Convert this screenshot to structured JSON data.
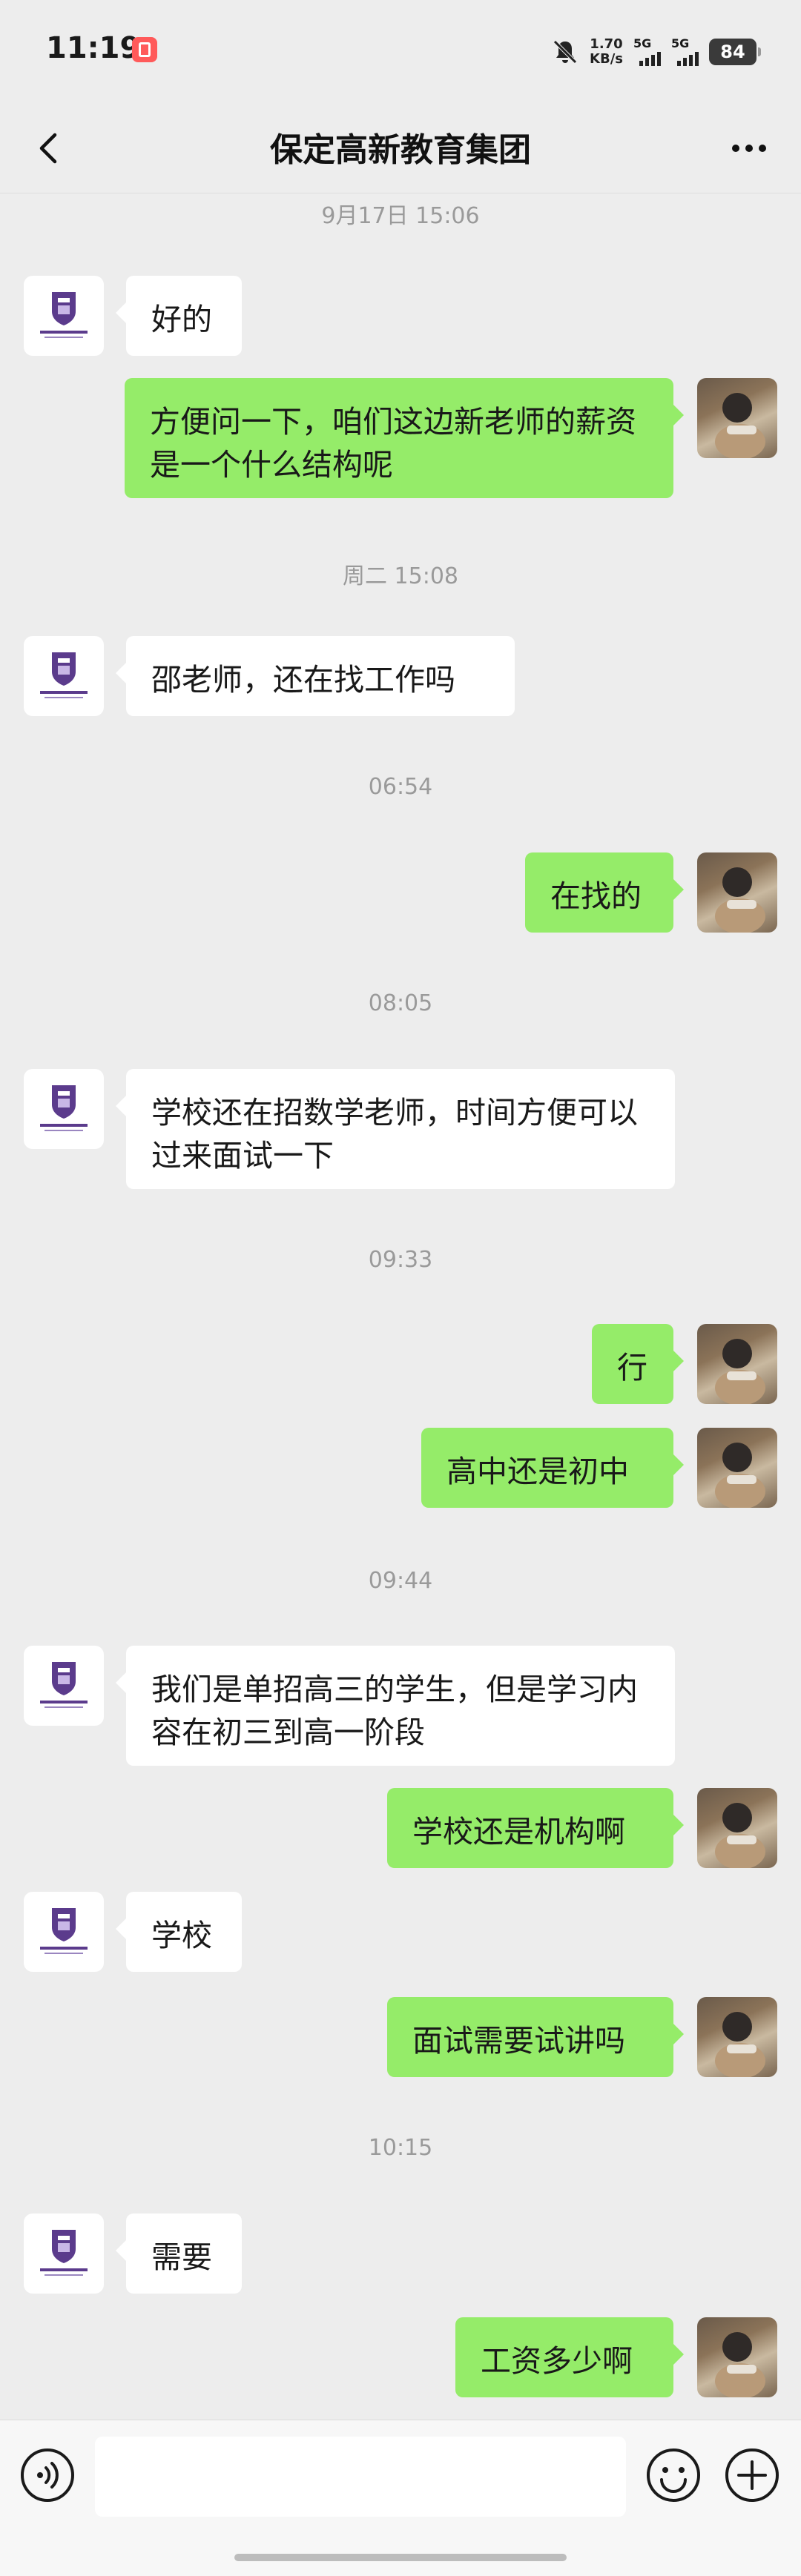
{
  "status_bar": {
    "time": "11:19",
    "net_speed_value": "1.70",
    "net_speed_unit": "KB/s",
    "sim1_label": "5G",
    "sim2_label": "5G",
    "battery": "84"
  },
  "header": {
    "title": "保定高新教育集团"
  },
  "timestamps": [
    "9月17日 15:06",
    "周二 15:08",
    "06:54",
    "08:05",
    "09:33",
    "09:44",
    "10:15"
  ],
  "messages": [
    {
      "side": "left",
      "text": "好的"
    },
    {
      "side": "right",
      "text": "方便问一下，咱们这边新老师的薪资是一个什么结构呢"
    },
    {
      "side": "left",
      "text": "邵老师，还在找工作吗"
    },
    {
      "side": "right",
      "text": "在找的"
    },
    {
      "side": "left",
      "text": "学校还在招数学老师，时间方便可以过来面试一下"
    },
    {
      "side": "right",
      "text": "行"
    },
    {
      "side": "right",
      "text": "高中还是初中"
    },
    {
      "side": "left",
      "text": "我们是单招高三的学生，但是学习内容在初三到高一阶段"
    },
    {
      "side": "right",
      "text": "学校还是机构啊"
    },
    {
      "side": "left",
      "text": "学校"
    },
    {
      "side": "right",
      "text": "面试需要试讲吗"
    },
    {
      "side": "left",
      "text": "需要"
    },
    {
      "side": "right",
      "text": "工资多少啊"
    }
  ],
  "input_bar": {
    "voice_icon": "voice-icon",
    "emoji_icon": "emoji-icon",
    "plus_icon": "plus-icon"
  },
  "colors": {
    "background": "#ededed",
    "bubble_self": "#95ec69",
    "bubble_other": "#ffffff",
    "logo_purple": "#5b3b8c"
  }
}
